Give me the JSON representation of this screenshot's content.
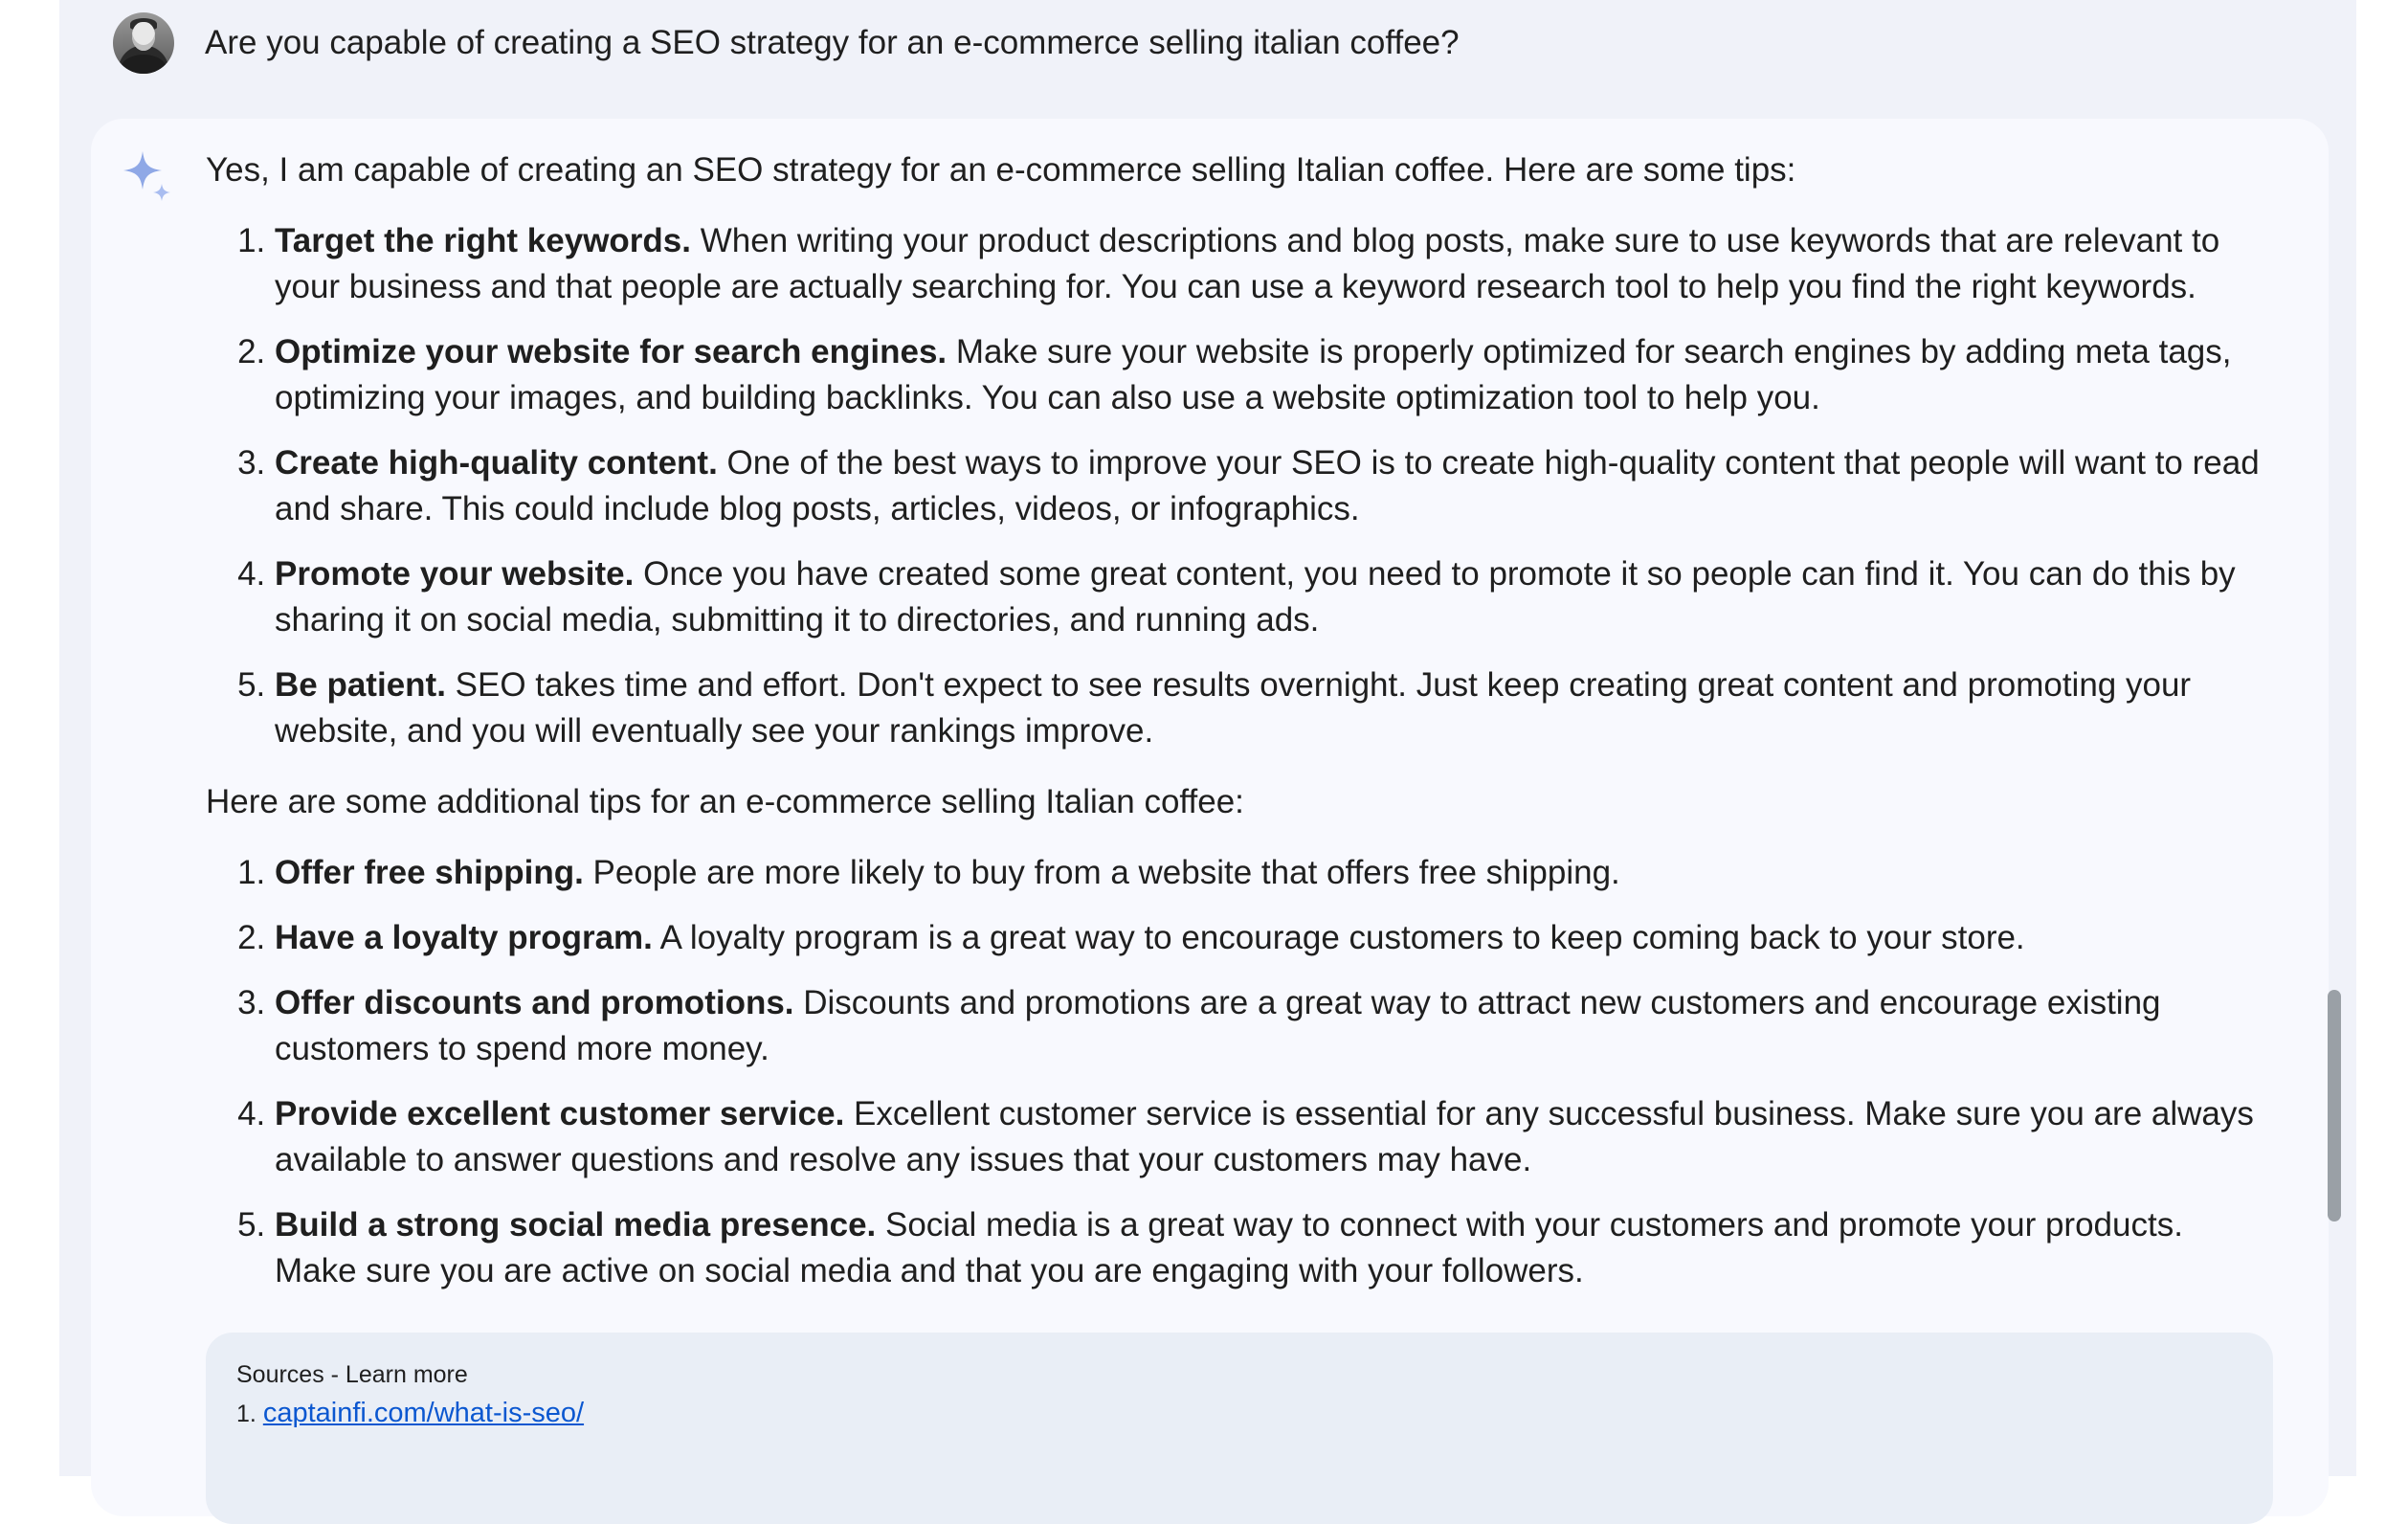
{
  "user_message": {
    "text": "Are you capable of creating a SEO strategy for an e-commerce selling italian coffee?"
  },
  "response": {
    "intro": "Yes, I am capable of creating an SEO strategy for an e-commerce selling Italian coffee. Here are some tips:",
    "tips": [
      {
        "number": "1.",
        "title": "Target the right keywords.",
        "text": " When writing your product descriptions and blog posts, make sure to use keywords that are relevant to your business and that people are actually searching for. You can use a keyword research tool to help you find the right keywords."
      },
      {
        "number": "2.",
        "title": "Optimize your website for search engines.",
        "text": " Make sure your website is properly optimized for search engines by adding meta tags, optimizing your images, and building backlinks. You can also use a website optimization tool to help you."
      },
      {
        "number": "3.",
        "title": "Create high-quality content.",
        "text": " One of the best ways to improve your SEO is to create high-quality content that people will want to read and share. This could include blog posts, articles, videos, or infographics."
      },
      {
        "number": "4.",
        "title": "Promote your website.",
        "text": " Once you have created some great content, you need to promote it so people can find it. You can do this by sharing it on social media, submitting it to directories, and running ads."
      },
      {
        "number": "5.",
        "title": "Be patient.",
        "text": " SEO takes time and effort. Don't expect to see results overnight. Just keep creating great content and promoting your website, and you will eventually see your rankings improve."
      }
    ],
    "additional_intro": "Here are some additional tips for an e-commerce selling Italian coffee:",
    "additional_tips": [
      {
        "number": "1.",
        "title": "Offer free shipping.",
        "text": " People are more likely to buy from a website that offers free shipping."
      },
      {
        "number": "2.",
        "title": "Have a loyalty program.",
        "text": " A loyalty program is a great way to encourage customers to keep coming back to your store."
      },
      {
        "number": "3.",
        "title": "Offer discounts and promotions.",
        "text": " Discounts and promotions are a great way to attract new customers and encourage existing customers to spend more money."
      },
      {
        "number": "4.",
        "title": "Provide excellent customer service.",
        "text": " Excellent customer service is essential for any successful business. Make sure you are always available to answer questions and resolve any issues that your customers may have."
      },
      {
        "number": "5.",
        "title": "Build a strong social media presence.",
        "text": " Social media is a great way to connect with your customers and promote your products. Make sure you are active on social media and that you are engaging with your followers."
      }
    ]
  },
  "sources": {
    "title": "Sources - Learn more",
    "items": [
      {
        "number": "1.",
        "link_text": "captainfi.com/what-is-seo/"
      }
    ]
  },
  "icons": {
    "assistant": "sparkle-icon",
    "user": "avatar"
  },
  "colors": {
    "panel_background": "#f0f2f9",
    "card_background": "#f8f9fe",
    "sources_background": "#e9eef6",
    "link": "#0b57d0",
    "sparkle_blue": "#8fa8e6",
    "text": "#1f1f1f"
  }
}
